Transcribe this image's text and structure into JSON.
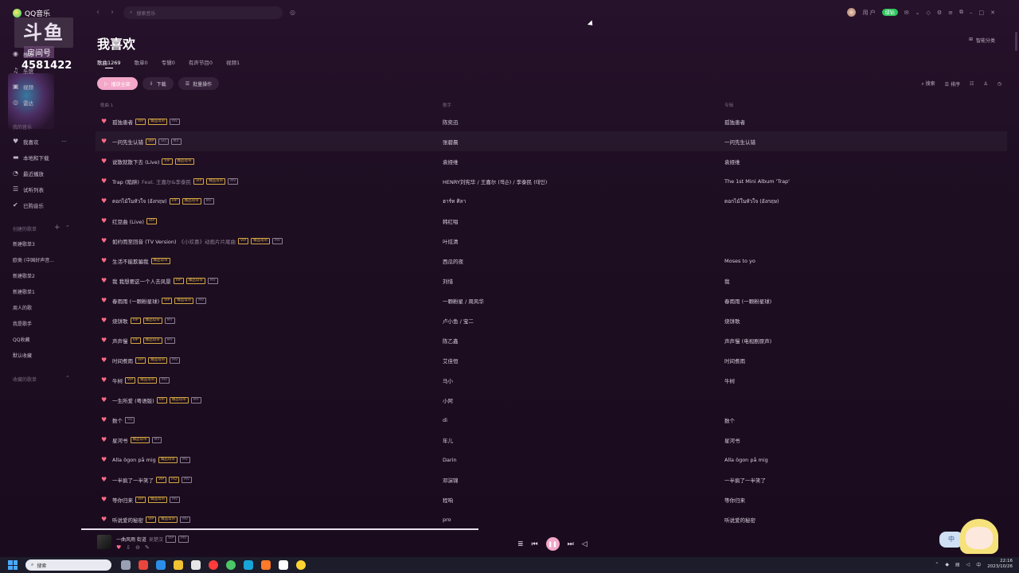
{
  "app": {
    "name": "QQ音乐"
  },
  "overlay": {
    "brand": "斗鱼",
    "sub": "房间号",
    "room_number": "4581422"
  },
  "sidebar": {
    "top_items": [
      {
        "label": "推荐",
        "icon": "home-icon"
      },
      {
        "label": "乐馆",
        "icon": "music-note-icon"
      },
      {
        "label": "视频",
        "icon": "video-icon"
      },
      {
        "label": "雷达",
        "icon": "radar-icon"
      }
    ],
    "my_music_header": "我的音乐",
    "my_items": [
      {
        "label": "我喜欢",
        "icon": "heart-icon",
        "more": "···"
      },
      {
        "label": "本地和下载",
        "icon": "download-icon"
      },
      {
        "label": "最近播放",
        "icon": "history-icon"
      },
      {
        "label": "试听列表",
        "icon": "list-icon"
      },
      {
        "label": "已购音乐",
        "icon": "check-circle-icon"
      }
    ],
    "created_header": "创建的歌单",
    "created_items": [
      "新建歌单3",
      "欧类 (中国好声音...",
      "新建歌单2",
      "新建歌单1",
      "周人的歌",
      "我是歌手",
      "QQ收藏",
      "默认收藏"
    ],
    "collected_header": "收藏的歌单"
  },
  "topbar": {
    "search_placeholder": "搜索音乐",
    "user_name": "用 户",
    "vip_label": "绿钻"
  },
  "page": {
    "title": "我喜欢",
    "tabs": [
      "歌曲1269",
      "歌单0",
      "专辑0",
      "有声节目0",
      "视频1"
    ],
    "smart_category": "智能分类",
    "play_all": "播放全部",
    "download": "下载",
    "batch": "批量操作",
    "search": "搜索",
    "sort": "排序"
  },
  "table": {
    "headers": {
      "title": "歌曲 1",
      "artist": "歌手",
      "album": "专辑"
    },
    "rows": [
      {
        "title": "孤独患者",
        "sub": "",
        "tags": [
          "VIP",
          "臻品母带",
          "MV"
        ],
        "artist": "陈奕迅",
        "album": "孤独患者"
      },
      {
        "title": "一问先生认错",
        "sub": "",
        "tags": [
          "VIP",
          "SQ",
          "MV"
        ],
        "artist": "张碧晨",
        "album": "一问先生认错"
      },
      {
        "title": "说散就散下去 (Live)",
        "sub": "",
        "tags": [
          "VIP",
          "臻品母带"
        ],
        "artist": "袁娅维",
        "album": "袁娅维"
      },
      {
        "title": "Trap (陷阱)",
        "sub": "Feat. 王嘉尔&李泰民",
        "tags": [
          "VIP",
          "臻品母带",
          "MV"
        ],
        "artist": "HENRY刘宪华 / 王嘉尔 (잭슨) / 李泰民 (태민)",
        "album": "The 1st Mini Album 'Trap'"
      },
      {
        "title": "ดอกไม้ในหัวใจ (อังกฤษ)",
        "sub": "",
        "tags": [
          "VIP",
          "臻品母带",
          "MV"
        ],
        "artist": "ฮาร์ท ศิลา",
        "album": "ดอกไม้ในหัวใจ (อังกฤษ)"
      },
      {
        "title": "红豆曲 (Live)",
        "sub": "",
        "tags": [
          "VIP"
        ],
        "artist": "韩红唱",
        "album": ""
      },
      {
        "title": "如约而至回音 (TV Version)",
        "sub": "《小欢喜》动画片片尾曲",
        "tags": [
          "VIP",
          "臻品母带",
          "MV"
        ],
        "artist": "叶炫清",
        "album": ""
      },
      {
        "title": "生活不能欺骗我",
        "sub": "",
        "tags": [
          "臻品母带"
        ],
        "artist": "西瓜的夜",
        "album": "Moses to yo"
      },
      {
        "title": "我 我想要这一个人去风景",
        "sub": "",
        "tags": [
          "VIP",
          "臻品母带",
          "MV"
        ],
        "artist": "刘惜",
        "album": "我"
      },
      {
        "title": "春雨雨 (一颗粉星球)",
        "sub": "",
        "tags": [
          "VIP",
          "臻品母带",
          "MV"
        ],
        "artist": "一颗粉星 / 周风华",
        "album": "春雨雨 (一颗粉星球)"
      },
      {
        "title": "烧饼歌",
        "sub": "",
        "tags": [
          "VIP",
          "臻品母带",
          "MV"
        ],
        "artist": "卢小鱼 / 宝二",
        "album": "烧饼歌"
      },
      {
        "title": "声声慢",
        "sub": "",
        "tags": [
          "VIP",
          "臻品母带",
          "MV"
        ],
        "artist": "陈乙鑫",
        "album": "声声慢 (电视剧原声)"
      },
      {
        "title": "时间煮雨",
        "sub": "",
        "tags": [
          "VIP",
          "臻品母带",
          "MV"
        ],
        "artist": "艾佳恒",
        "album": "时间煮雨"
      },
      {
        "title": "牛树",
        "sub": "",
        "tags": [
          "VIP",
          "臻品母带",
          "MV"
        ],
        "artist": "马小",
        "album": "牛树"
      },
      {
        "title": "一生所爱 (粤语版)",
        "sub": "",
        "tags": [
          "VIP",
          "臻品母带",
          "MV"
        ],
        "artist": "小阿",
        "album": ""
      },
      {
        "title": "数个",
        "sub": "",
        "tags": [
          "SQ"
        ],
        "artist": "di",
        "album": "数个"
      },
      {
        "title": "星河书",
        "sub": "",
        "tags": [
          "臻品母带",
          "MV"
        ],
        "artist": "年儿",
        "album": "星河书"
      },
      {
        "title": "Alla ögon på mig",
        "sub": "",
        "tags": [
          "臻品母带",
          "MV"
        ],
        "artist": "Darin",
        "album": "Alla ögon på mig"
      },
      {
        "title": "一半疯了一半笑了",
        "sub": "",
        "tags": [
          "VIP",
          "HQ",
          "MV"
        ],
        "artist": "邓演锦",
        "album": "一半疯了一半笑了"
      },
      {
        "title": "等你归来",
        "sub": "",
        "tags": [
          "VIP",
          "臻品母带",
          "MV"
        ],
        "artist": "程响",
        "album": "等你归来"
      },
      {
        "title": "听说爱的秘密",
        "sub": "",
        "tags": [
          "VIP",
          "臻品母带",
          "MV"
        ],
        "artist": "pro",
        "album": "听说爱的秘密"
      }
    ]
  },
  "player": {
    "track": "一曲风雨 街道",
    "artist": "吴楚汉",
    "tags": [
      "VIP",
      "MV"
    ],
    "progress": 0.43
  },
  "mascot": {
    "bubble": "中"
  },
  "taskbar": {
    "search_label": "搜索",
    "time": "22:16",
    "date": "2023/10/26"
  }
}
